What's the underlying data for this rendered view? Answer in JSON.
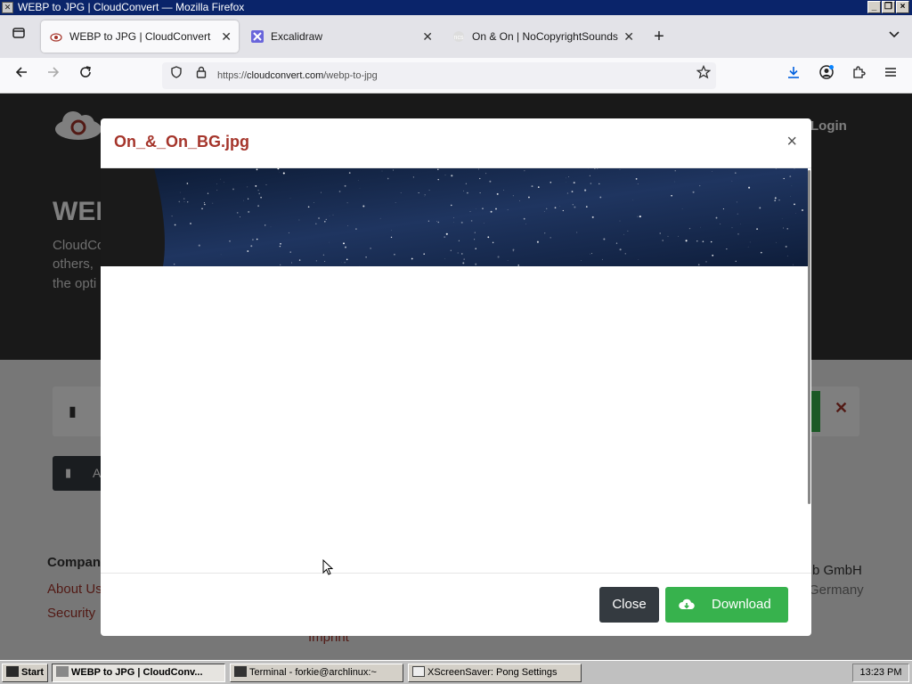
{
  "window": {
    "title": "WEBP to JPG | CloudConvert — Mozilla Firefox"
  },
  "tabs": [
    {
      "label": "WEBP to JPG | CloudConvert",
      "active": true
    },
    {
      "label": "Excalidraw",
      "active": false
    },
    {
      "label": "On & On | NoCopyrightSounds Wiki",
      "active": false
    }
  ],
  "urlbar": {
    "domain_prefix": "https://",
    "domain": "cloudconvert.com",
    "path": "/webp-to-jpg"
  },
  "background_page": {
    "login": "Login",
    "heading_fragment": "WEB",
    "para_line1": "CloudCo",
    "para_line2": "others,",
    "para_line3": "the opti",
    "add_button_fragment": "A",
    "footer_heading": "Compan",
    "footer_link1": "About Us",
    "footer_link2": "Security",
    "footer_link3": "Imprint",
    "footer_right1": "b GmbH",
    "footer_right2": "Germany"
  },
  "modal": {
    "title": "On_&_On_BG.jpg",
    "close_label": "Close",
    "download_label": "Download"
  },
  "taskbar": {
    "start": "Start",
    "items": [
      {
        "label": "WEBP to JPG | CloudConv...",
        "pressed": true
      },
      {
        "label": "Terminal - forkie@archlinux:~",
        "pressed": false
      },
      {
        "label": "XScreenSaver: Pong Settings",
        "pressed": false
      }
    ],
    "clock": "13:23 PM"
  },
  "colors": {
    "accent_red": "#a5352b",
    "download_green": "#37b24d",
    "close_dark": "#343a40"
  }
}
